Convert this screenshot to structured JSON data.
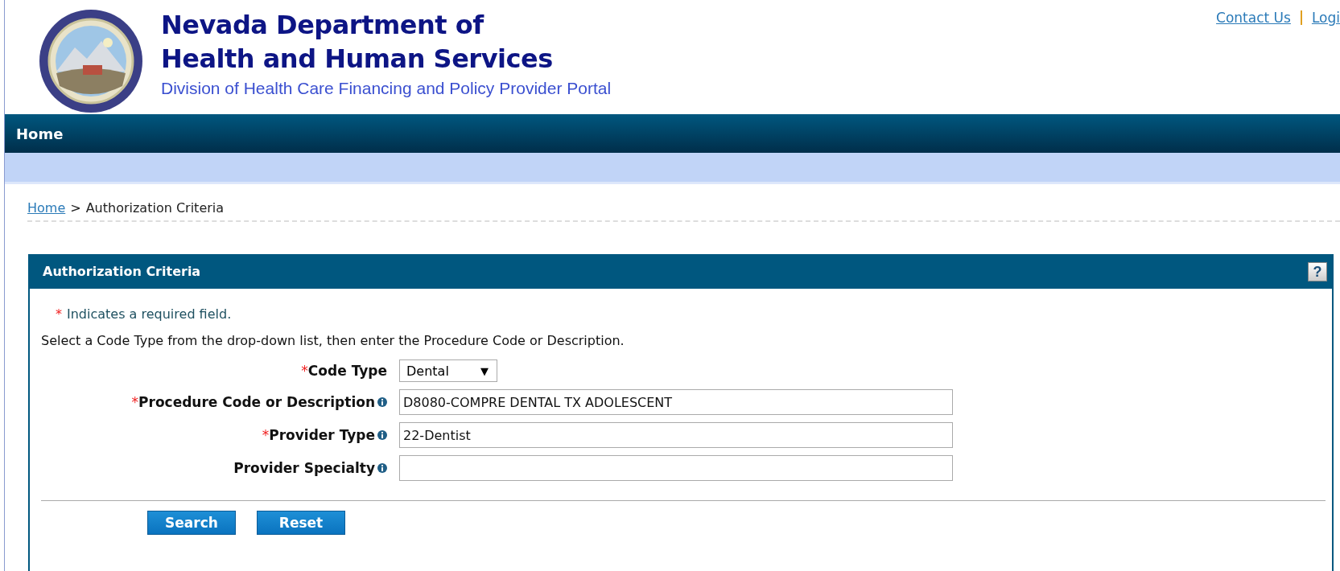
{
  "header": {
    "title_lines": [
      "Nevada Department of",
      "Health and Human Services"
    ],
    "subtitle": "Division of Health Care Financing and Policy Provider Portal"
  },
  "top_links": [
    "Contact Us",
    "Logi"
  ],
  "nav": {
    "items": [
      {
        "label": "Home"
      }
    ]
  },
  "breadcrumb": {
    "link": "Home",
    "separator": ">",
    "current": "Authorization Criteria"
  },
  "panel": {
    "title": "Authorization Criteria",
    "help": "?",
    "required_note": {
      "mark": "*",
      "text": "Indicates a required field."
    },
    "instructions": "Select a Code Type from the drop-down list, then enter the Procedure Code or Description.",
    "fields": [
      {
        "kind": "select",
        "label": "Code Type",
        "required": true,
        "info": false,
        "value": "Dental",
        "caret": "▼"
      },
      {
        "kind": "text",
        "label": "Procedure Code or Description",
        "required": true,
        "info": true,
        "value": "D8080-COMPRE DENTAL TX ADOLESCENT"
      },
      {
        "kind": "text",
        "label": "Provider Type",
        "required": true,
        "info": true,
        "value": "22-Dentist"
      },
      {
        "kind": "text",
        "label": "Provider Specialty",
        "required": false,
        "info": true
      }
    ],
    "buttons": [
      "Search",
      "Reset"
    ]
  }
}
